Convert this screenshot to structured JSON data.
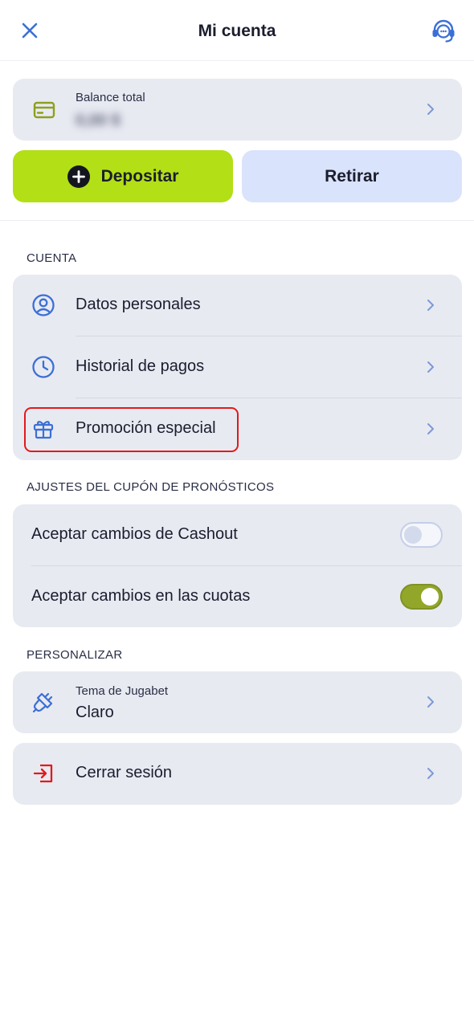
{
  "header": {
    "title": "Mi cuenta"
  },
  "balance": {
    "label": "Balance total",
    "value": "0,00 $"
  },
  "actions": {
    "deposit_label": "Depositar",
    "withdraw_label": "Retirar"
  },
  "sections": {
    "account": {
      "label": "CUENTA",
      "items": [
        {
          "label": "Datos personales",
          "icon": "user-circle-icon"
        },
        {
          "label": "Historial de pagos",
          "icon": "clock-icon"
        },
        {
          "label": "Promoción especial",
          "icon": "gift-icon"
        }
      ]
    },
    "coupon": {
      "label": "AJUSTES DEL CUPÓN DE PRONÓSTICOS",
      "items": [
        {
          "label": "Aceptar cambios de Cashout",
          "enabled": false
        },
        {
          "label": "Aceptar cambios en las cuotas",
          "enabled": true
        }
      ]
    },
    "customize": {
      "label": "PERSONALIZAR",
      "theme_label": "Tema de Jugabet",
      "theme_value": "Claro",
      "logout_label": "Cerrar sesión"
    }
  },
  "colors": {
    "accent_blue": "#3b6fd6",
    "lime": "#b3df16",
    "danger": "#e21a1a",
    "icon_olive": "#8e9f1c"
  }
}
